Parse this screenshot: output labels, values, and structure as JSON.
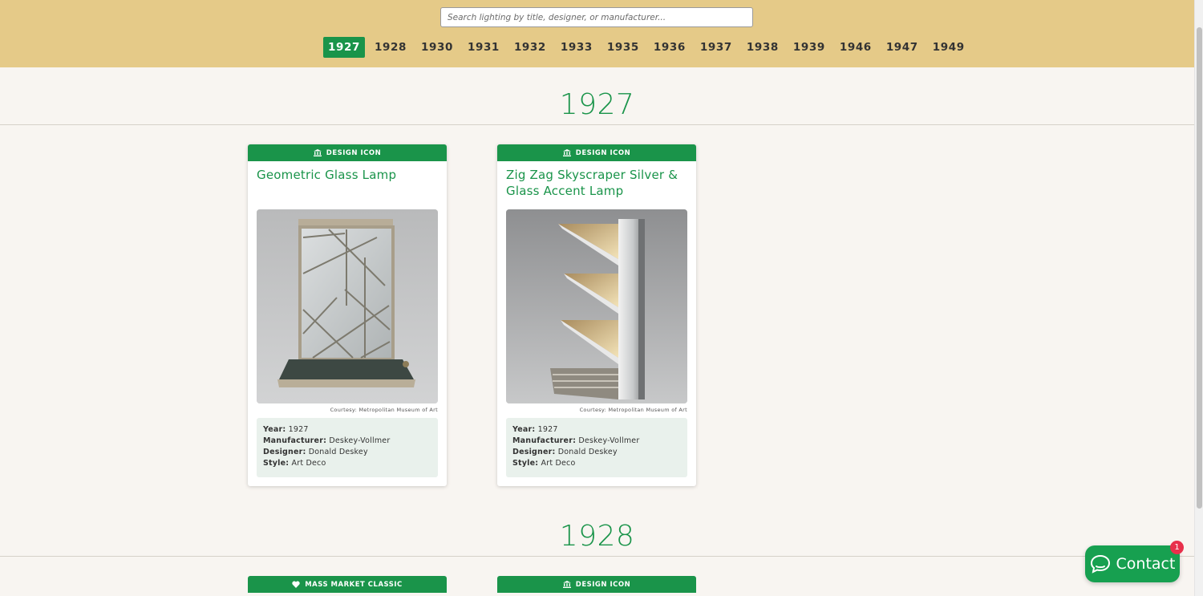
{
  "search": {
    "placeholder": "Search lighting by title, designer, or manufacturer..."
  },
  "year_nav": {
    "active": "1927",
    "years": [
      "1927",
      "1928",
      "1930",
      "1931",
      "1932",
      "1933",
      "1935",
      "1936",
      "1937",
      "1938",
      "1939",
      "1946",
      "1947",
      "1949"
    ]
  },
  "sections": [
    {
      "year": "1927",
      "cards": [
        {
          "badge": "DESIGN ICON",
          "badge_icon": "museum-icon",
          "title": "Geometric Glass Lamp",
          "credit": "Courtesy: Metropolitan Museum of Art",
          "specs": {
            "year_label": "Year:",
            "year": "1927",
            "manufacturer_label": "Manufacturer:",
            "manufacturer": "Deskey-Vollmer",
            "designer_label": "Designer:",
            "designer": "Donald Deskey",
            "style_label": "Style:",
            "style": "Art Deco"
          }
        },
        {
          "badge": "DESIGN ICON",
          "badge_icon": "museum-icon",
          "title": "Zig Zag Skyscraper Silver & Glass Accent Lamp",
          "credit": "Courtesy: Metropolitan Museum of Art",
          "specs": {
            "year_label": "Year:",
            "year": "1927",
            "manufacturer_label": "Manufacturer:",
            "manufacturer": "Deskey-Vollmer",
            "designer_label": "Designer:",
            "designer": "Donald Deskey",
            "style_label": "Style:",
            "style": "Art Deco"
          }
        }
      ]
    },
    {
      "year": "1928",
      "cards": [
        {
          "badge": "MASS MARKET CLASSIC",
          "badge_icon": "heart-icon"
        },
        {
          "badge": "DESIGN ICON",
          "badge_icon": "museum-icon"
        }
      ]
    }
  ],
  "contact": {
    "label": "Contact",
    "badge_count": "1",
    "icon": "chat-bubble-icon"
  },
  "colors": {
    "header_bg": "#e5ca88",
    "accent_green": "#1a944a",
    "page_bg": "#f8f5f1",
    "notif_red": "#e8304b"
  }
}
